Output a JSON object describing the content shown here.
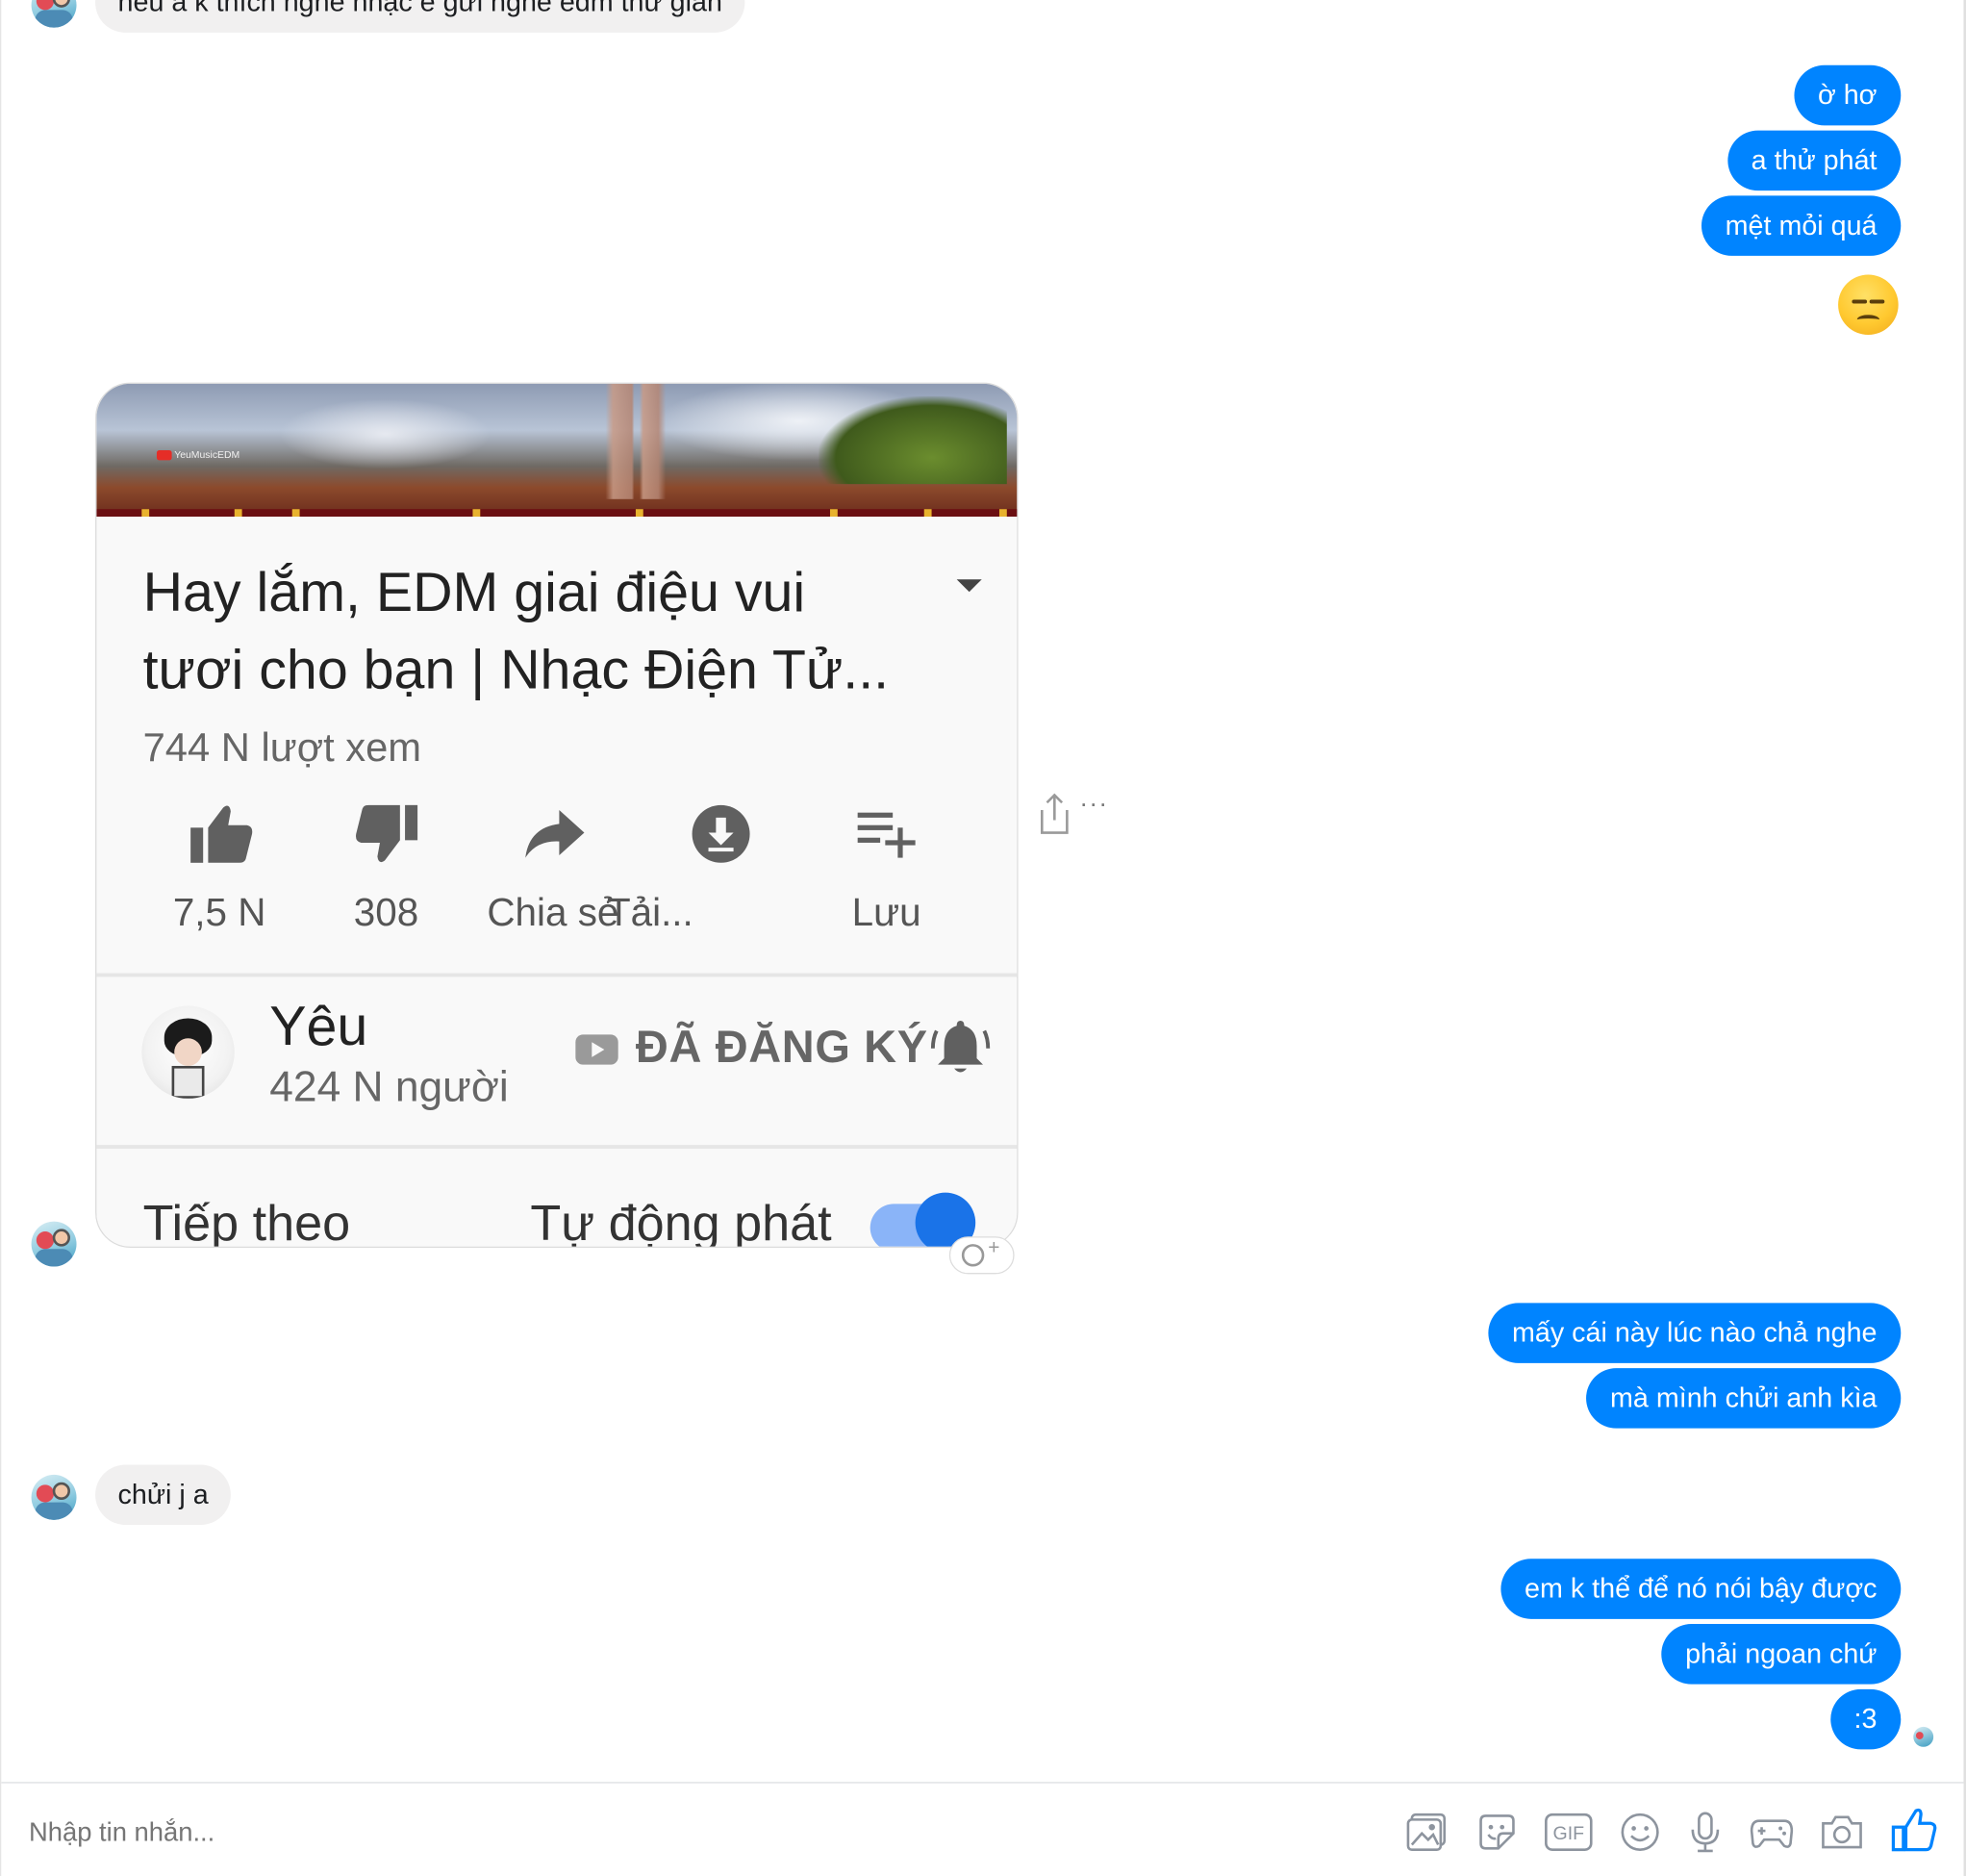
{
  "messages": {
    "top_incoming_partial": "nếu a k thích nghe nhạc e gửi nghe edm thư giãn",
    "outgoing_group_1": [
      "ờ hơ",
      "a thử phát",
      "mệt mỏi quá"
    ],
    "outgoing_group_2": [
      "mấy cái này lúc nào chả nghe",
      "mà mình chửi anh kìa"
    ],
    "incoming_2": "chửi j a",
    "outgoing_group_3": [
      "em k thể để nó nói bậy được",
      "phải ngoan chứ",
      ":3"
    ]
  },
  "youtube_card": {
    "watermark": "YeuMusicEDM",
    "title_line1": "Hay lắm, EDM giai điệu vui",
    "title_line2": "tươi cho bạn | Nhạc Điện Tử...",
    "views": "744 N lượt xem",
    "actions": {
      "like": "7,5 N",
      "dislike": "308",
      "share": "Chia sẻ",
      "download": "Tải...",
      "save": "Lưu"
    },
    "channel": {
      "name": "Yêu",
      "subscribers": "424 N người",
      "subscribed_label": "ĐÃ ĐĂNG KÝ"
    },
    "up_next": {
      "label": "Tiếp theo",
      "autoplay": "Tự động phát",
      "autoplay_on": true
    }
  },
  "side_actions": {
    "more": "···"
  },
  "composer": {
    "placeholder": "Nhập tin nhắn..."
  },
  "colors": {
    "outgoing_bubble": "#0084ff",
    "incoming_bubble": "#f1f0f0",
    "accent": "#0084ff"
  },
  "icons": [
    "image-icon",
    "sticker-icon",
    "gif-icon",
    "emoji-icon",
    "microphone-icon",
    "game-icon",
    "camera-icon",
    "thumbs-up-icon"
  ]
}
